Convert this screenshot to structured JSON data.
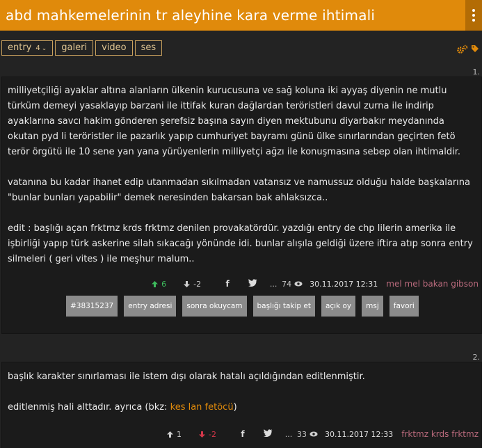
{
  "header": {
    "title": "abd mahkemelerinin tr aleyhine kara verme ihtimali",
    "menu_icon": "vertical-dots-icon"
  },
  "tabs": [
    {
      "label": "entry",
      "count": "4",
      "caret": "⌄"
    },
    {
      "label": "galeri"
    },
    {
      "label": "video"
    },
    {
      "label": "ses"
    }
  ],
  "tools": {
    "settings_icon": "gears-icon",
    "tag_icon": "tag-icon"
  },
  "entries": [
    {
      "number": "1.",
      "paragraphs": [
        "milliyetçiliği ayaklar altına alanların ülkenin kurucusuna ve sağ koluna iki ayyaş diyenin ne mutlu türküm demeyi yasaklayıp barzani ile ittifak kuran dağlardan teröristleri davul zurna ile indirip ayaklarına savcı hakim gönderen şerefsiz başına sayın diyen mektubunu diyarbakır meydanında okutan pyd li teröristler ile pazarlık yapıp cumhuriyet bayramı günü ülke sınırlarından geçirten fetö terör örgütü ile 10 sene yan yana yürüyenlerin milliyetçi ağzı ile konuşmasına sebep olan ihtimaldir.",
        "vatanına bu kadar ihanet edip utanmadan sıkılmadan vatansız ve namussuz olduğu halde başkalarına \"bunlar bunları yapabilir\" demek neresinden bakarsan bak ahlaksızca..",
        "edit : başlığı açan frktmz krds frktmz denilen provakatördür. yazdığı entry de chp lilerin amerika ile işbirliği yapıp türk askerine silah sıkacağı yönünde idi. bunlar alışıla geldiği üzere iftira atıp sonra entry silmeleri ( geri vites ) ile meşhur malum.."
      ],
      "upvotes": "6",
      "downvotes": "-2",
      "favorites": "74",
      "date": "30.11.2017 12:31",
      "author": "mel mel bakan gibson",
      "actions": [
        "#38315237",
        "entry adresi",
        "sonra okuycam",
        "başlığı takip et",
        "açık oy",
        "msj",
        "favori"
      ]
    },
    {
      "number": "2.",
      "line1": "başlık karakter sınırlaması ile istem dışı olarak hatalı açıldığından editlenmiştir.",
      "line2_prefix": "editlenmiş hali alttadır. ayrıca (bkz: ",
      "line2_link": "kes lan fetöcü",
      "line2_suffix": ")",
      "upvotes": "1",
      "downvotes": "-2",
      "favorites": "33",
      "date": "30.11.2017 12:33",
      "author": "frktmz krds frktmz"
    }
  ],
  "icons": {
    "up": "arrow-up-icon",
    "down": "arrow-down-icon",
    "facebook": "facebook-icon",
    "twitter": "twitter-icon",
    "more": "more-dots-icon",
    "eye": "eye-icon"
  },
  "colors": {
    "brand": "#e08a0b",
    "upvote": "#3dbb5c",
    "downvote": "#d4374a",
    "author": "#b96a7c",
    "action_button": "#8b8b8b"
  }
}
